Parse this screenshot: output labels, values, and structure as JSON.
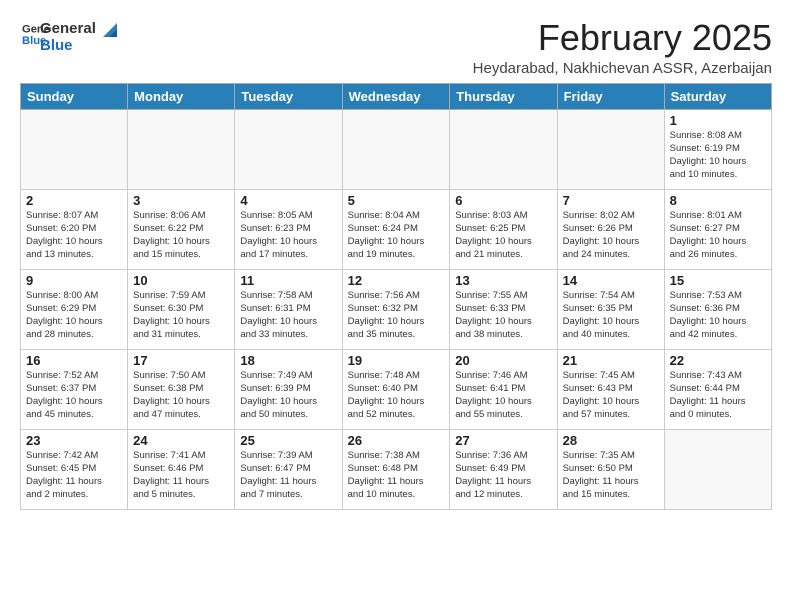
{
  "logo": {
    "line1": "General",
    "line2": "Blue"
  },
  "title": "February 2025",
  "location": "Heydarabad, Nakhichevan ASSR, Azerbaijan",
  "weekdays": [
    "Sunday",
    "Monday",
    "Tuesday",
    "Wednesday",
    "Thursday",
    "Friday",
    "Saturday"
  ],
  "weeks": [
    [
      {
        "day": "",
        "info": ""
      },
      {
        "day": "",
        "info": ""
      },
      {
        "day": "",
        "info": ""
      },
      {
        "day": "",
        "info": ""
      },
      {
        "day": "",
        "info": ""
      },
      {
        "day": "",
        "info": ""
      },
      {
        "day": "1",
        "info": "Sunrise: 8:08 AM\nSunset: 6:19 PM\nDaylight: 10 hours\nand 10 minutes."
      }
    ],
    [
      {
        "day": "2",
        "info": "Sunrise: 8:07 AM\nSunset: 6:20 PM\nDaylight: 10 hours\nand 13 minutes."
      },
      {
        "day": "3",
        "info": "Sunrise: 8:06 AM\nSunset: 6:22 PM\nDaylight: 10 hours\nand 15 minutes."
      },
      {
        "day": "4",
        "info": "Sunrise: 8:05 AM\nSunset: 6:23 PM\nDaylight: 10 hours\nand 17 minutes."
      },
      {
        "day": "5",
        "info": "Sunrise: 8:04 AM\nSunset: 6:24 PM\nDaylight: 10 hours\nand 19 minutes."
      },
      {
        "day": "6",
        "info": "Sunrise: 8:03 AM\nSunset: 6:25 PM\nDaylight: 10 hours\nand 21 minutes."
      },
      {
        "day": "7",
        "info": "Sunrise: 8:02 AM\nSunset: 6:26 PM\nDaylight: 10 hours\nand 24 minutes."
      },
      {
        "day": "8",
        "info": "Sunrise: 8:01 AM\nSunset: 6:27 PM\nDaylight: 10 hours\nand 26 minutes."
      }
    ],
    [
      {
        "day": "9",
        "info": "Sunrise: 8:00 AM\nSunset: 6:29 PM\nDaylight: 10 hours\nand 28 minutes."
      },
      {
        "day": "10",
        "info": "Sunrise: 7:59 AM\nSunset: 6:30 PM\nDaylight: 10 hours\nand 31 minutes."
      },
      {
        "day": "11",
        "info": "Sunrise: 7:58 AM\nSunset: 6:31 PM\nDaylight: 10 hours\nand 33 minutes."
      },
      {
        "day": "12",
        "info": "Sunrise: 7:56 AM\nSunset: 6:32 PM\nDaylight: 10 hours\nand 35 minutes."
      },
      {
        "day": "13",
        "info": "Sunrise: 7:55 AM\nSunset: 6:33 PM\nDaylight: 10 hours\nand 38 minutes."
      },
      {
        "day": "14",
        "info": "Sunrise: 7:54 AM\nSunset: 6:35 PM\nDaylight: 10 hours\nand 40 minutes."
      },
      {
        "day": "15",
        "info": "Sunrise: 7:53 AM\nSunset: 6:36 PM\nDaylight: 10 hours\nand 42 minutes."
      }
    ],
    [
      {
        "day": "16",
        "info": "Sunrise: 7:52 AM\nSunset: 6:37 PM\nDaylight: 10 hours\nand 45 minutes."
      },
      {
        "day": "17",
        "info": "Sunrise: 7:50 AM\nSunset: 6:38 PM\nDaylight: 10 hours\nand 47 minutes."
      },
      {
        "day": "18",
        "info": "Sunrise: 7:49 AM\nSunset: 6:39 PM\nDaylight: 10 hours\nand 50 minutes."
      },
      {
        "day": "19",
        "info": "Sunrise: 7:48 AM\nSunset: 6:40 PM\nDaylight: 10 hours\nand 52 minutes."
      },
      {
        "day": "20",
        "info": "Sunrise: 7:46 AM\nSunset: 6:41 PM\nDaylight: 10 hours\nand 55 minutes."
      },
      {
        "day": "21",
        "info": "Sunrise: 7:45 AM\nSunset: 6:43 PM\nDaylight: 10 hours\nand 57 minutes."
      },
      {
        "day": "22",
        "info": "Sunrise: 7:43 AM\nSunset: 6:44 PM\nDaylight: 11 hours\nand 0 minutes."
      }
    ],
    [
      {
        "day": "23",
        "info": "Sunrise: 7:42 AM\nSunset: 6:45 PM\nDaylight: 11 hours\nand 2 minutes."
      },
      {
        "day": "24",
        "info": "Sunrise: 7:41 AM\nSunset: 6:46 PM\nDaylight: 11 hours\nand 5 minutes."
      },
      {
        "day": "25",
        "info": "Sunrise: 7:39 AM\nSunset: 6:47 PM\nDaylight: 11 hours\nand 7 minutes."
      },
      {
        "day": "26",
        "info": "Sunrise: 7:38 AM\nSunset: 6:48 PM\nDaylight: 11 hours\nand 10 minutes."
      },
      {
        "day": "27",
        "info": "Sunrise: 7:36 AM\nSunset: 6:49 PM\nDaylight: 11 hours\nand 12 minutes."
      },
      {
        "day": "28",
        "info": "Sunrise: 7:35 AM\nSunset: 6:50 PM\nDaylight: 11 hours\nand 15 minutes."
      },
      {
        "day": "",
        "info": ""
      }
    ]
  ]
}
